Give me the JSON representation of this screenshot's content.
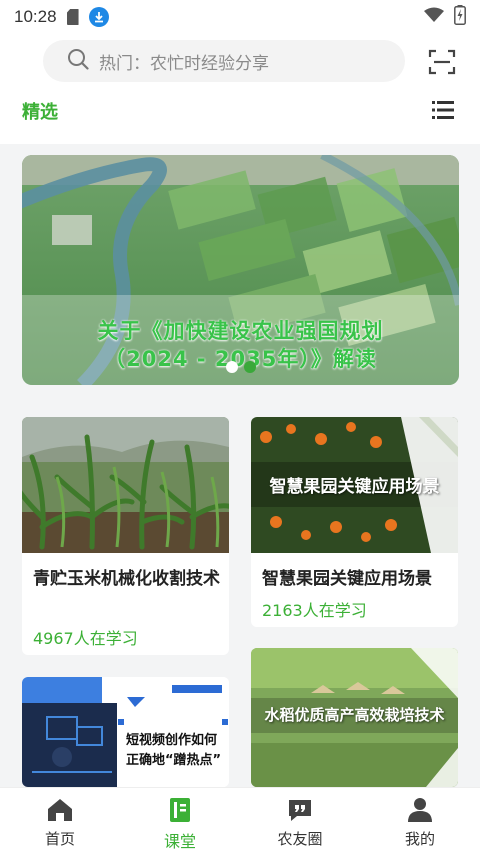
{
  "status_bar": {
    "time": "10:28"
  },
  "search": {
    "placeholder": "热门：农忙时经验分享"
  },
  "header": {
    "featured_label": "精选"
  },
  "banner": {
    "title_line1": "关于《加快建设农业强国规划",
    "title_line2": "（2024 - 2035年）》解读",
    "slides_total": 2,
    "active_slide": 2
  },
  "courses": [
    {
      "title": "青贮玉米机械化收割技术",
      "learners": "4967人在学习",
      "image_text": ""
    },
    {
      "title": "智慧果园关键应用场景",
      "learners": "2163人在学习",
      "image_text": "智慧果园关键应用场景"
    },
    {
      "title": "",
      "learners": "",
      "image_text_line1": "短视频创作如何",
      "image_text_line2": "正确地“蹭热点”"
    },
    {
      "title": "",
      "learners": "",
      "image_text": "水稻优质高产高效栽培技术"
    }
  ],
  "bottom_nav": [
    {
      "label": "首页",
      "icon": "home-icon",
      "active": false
    },
    {
      "label": "课堂",
      "icon": "book-icon",
      "active": true
    },
    {
      "label": "农友圈",
      "icon": "chat-quote-icon",
      "active": false
    },
    {
      "label": "我的",
      "icon": "user-icon",
      "active": false
    }
  ],
  "colors": {
    "accent": "#3cb036",
    "search_bg": "#f3f3f3",
    "page_bg": "#f3f4f5"
  }
}
